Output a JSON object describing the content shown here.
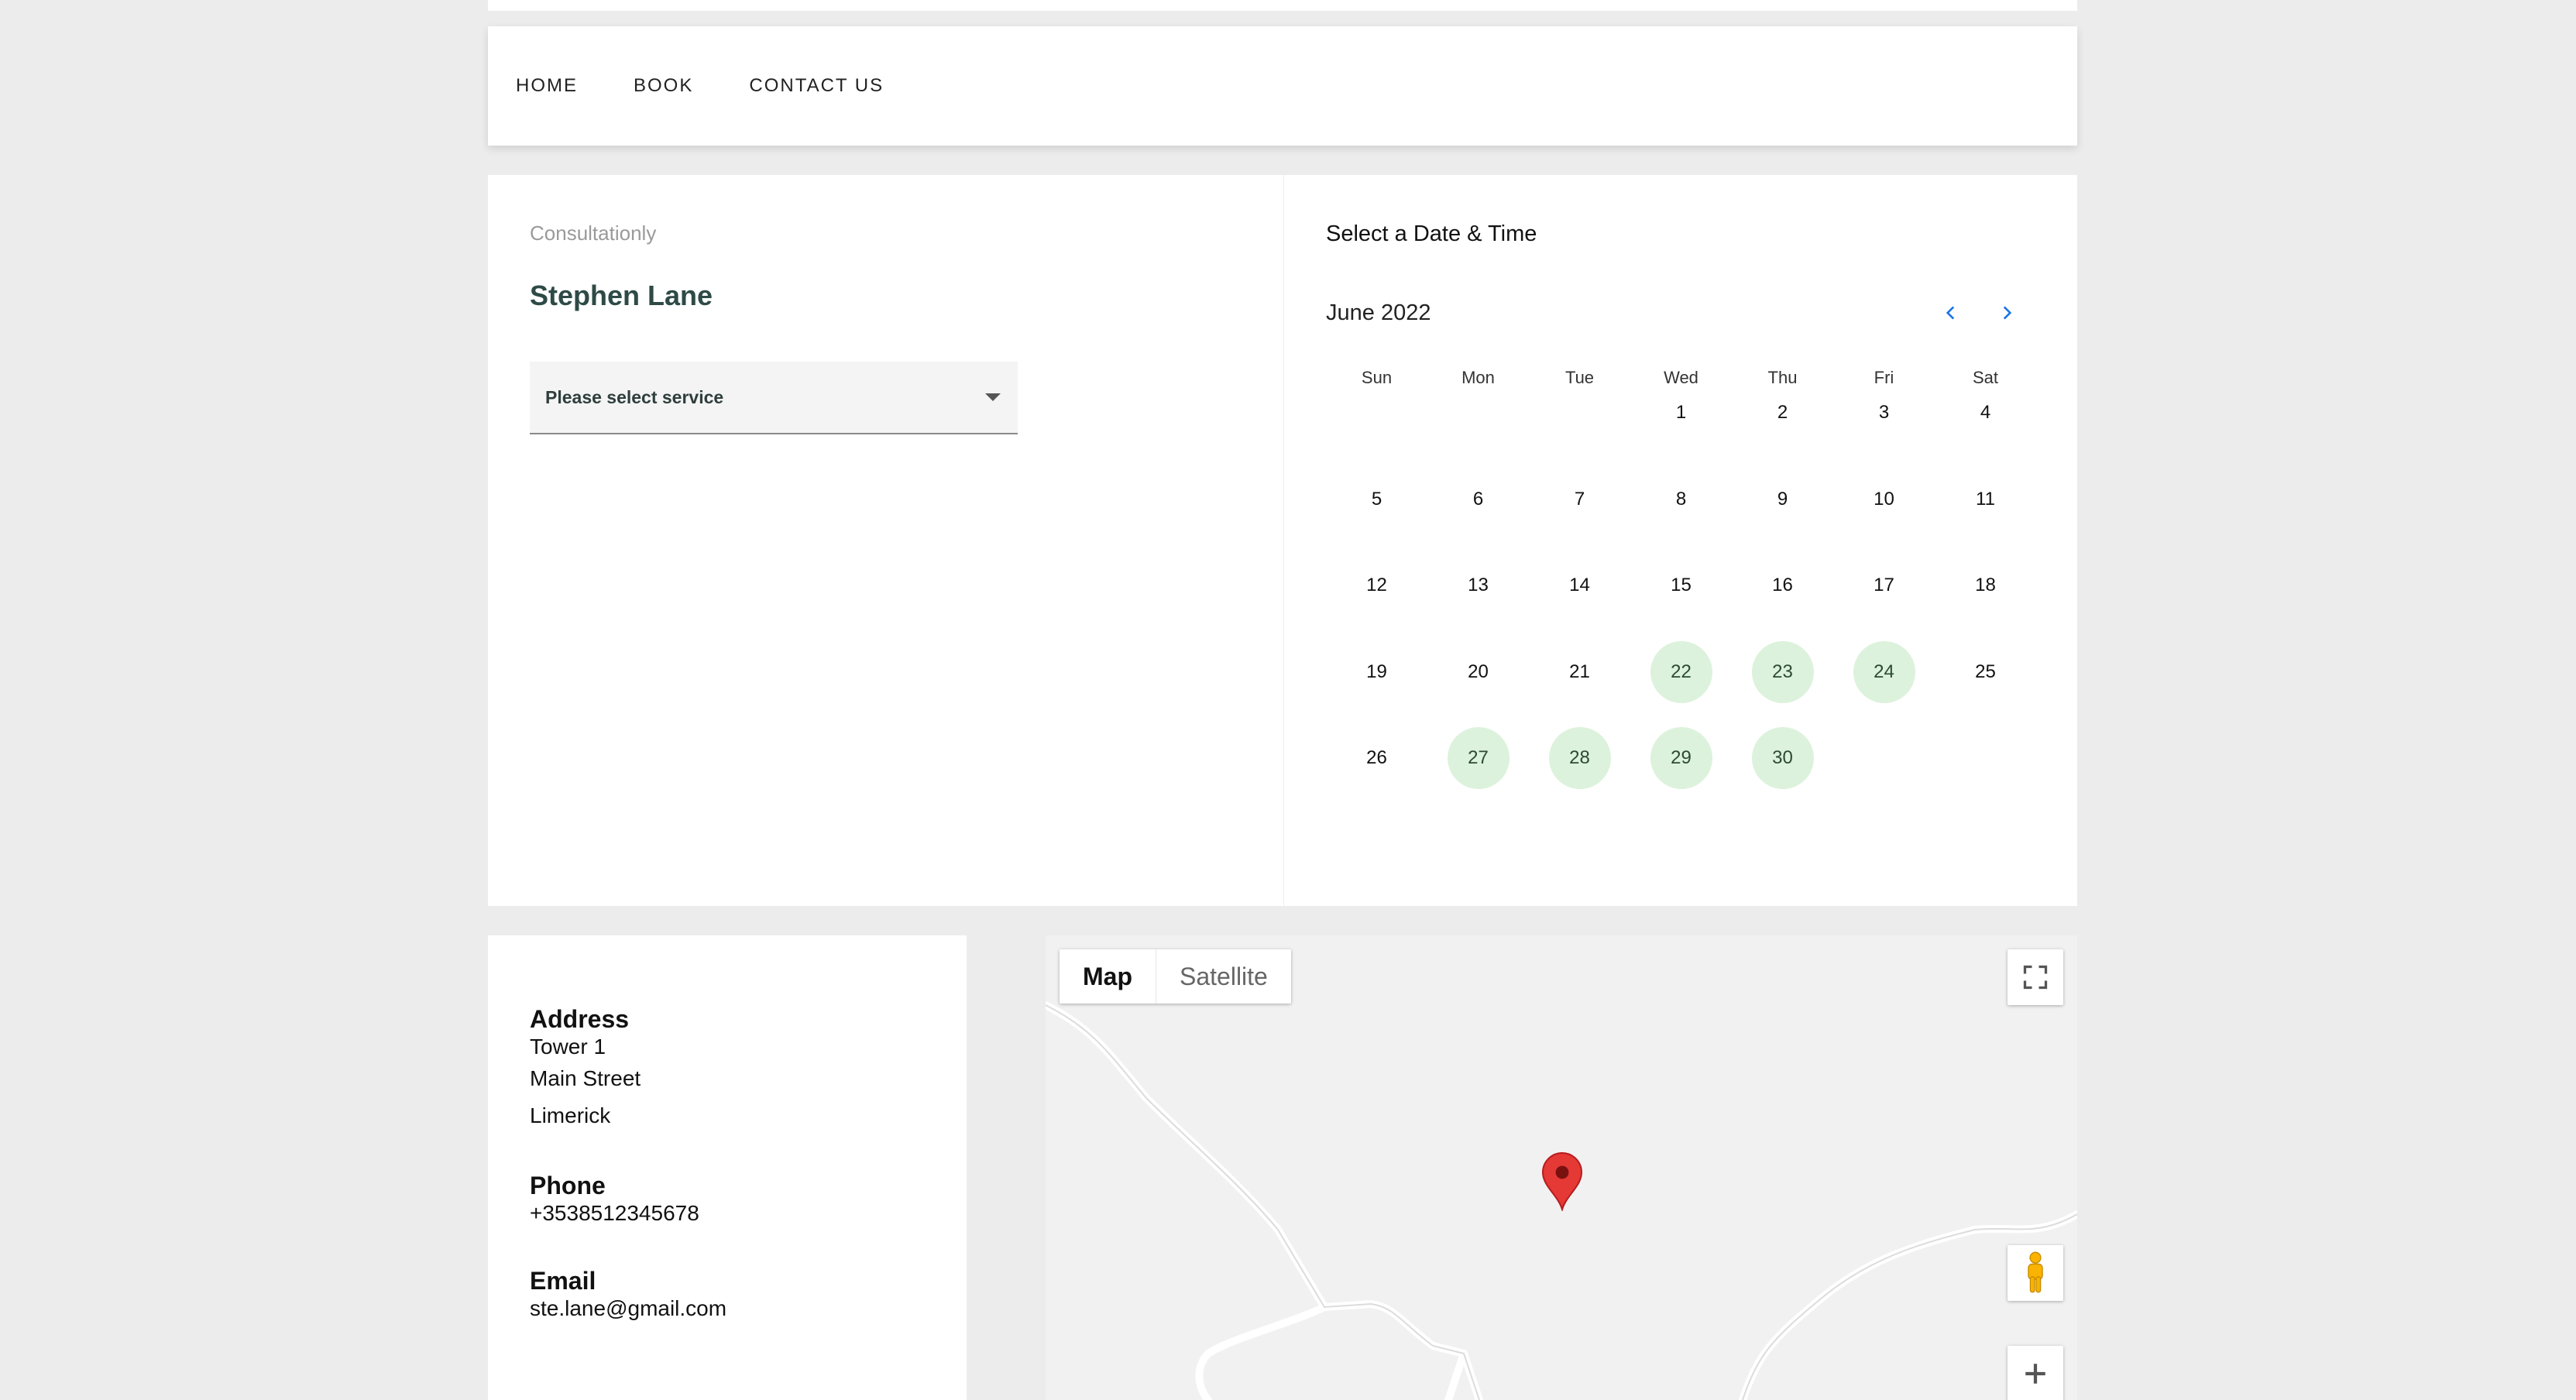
{
  "nav": {
    "items": [
      "HOME",
      "BOOK",
      "CONTACT US"
    ]
  },
  "booking": {
    "company": "Consultationly",
    "person": "Stephen Lane",
    "service_placeholder": "Please select service"
  },
  "calendar": {
    "heading": "Select a Date & Time",
    "month": "June 2022",
    "weekdays": [
      "Sun",
      "Mon",
      "Tue",
      "Wed",
      "Thu",
      "Fri",
      "Sat"
    ],
    "leading_blanks": 3,
    "days": [
      "1",
      "2",
      "3",
      "4",
      "5",
      "6",
      "7",
      "8",
      "9",
      "10",
      "11",
      "12",
      "13",
      "14",
      "15",
      "16",
      "17",
      "18",
      "19",
      "20",
      "21",
      "22",
      "23",
      "24",
      "25",
      "26",
      "27",
      "28",
      "29",
      "30"
    ],
    "available": [
      "22",
      "23",
      "24",
      "27",
      "28",
      "29",
      "30"
    ],
    "available_color": "#dcf2dc"
  },
  "contact": {
    "address_label": "Address",
    "address_lines": [
      "Tower 1",
      "Main Street",
      "Limerick"
    ],
    "phone_label": "Phone",
    "phone": "+3538512345678",
    "email_label": "Email",
    "email": "ste.lane@gmail.com"
  },
  "map": {
    "type_map": "Map",
    "type_satellite": "Satellite",
    "icons": [
      "fullscreen-icon",
      "pegman-icon",
      "zoom-in-icon",
      "map-pin-icon"
    ],
    "pin_color": "#e53935"
  }
}
